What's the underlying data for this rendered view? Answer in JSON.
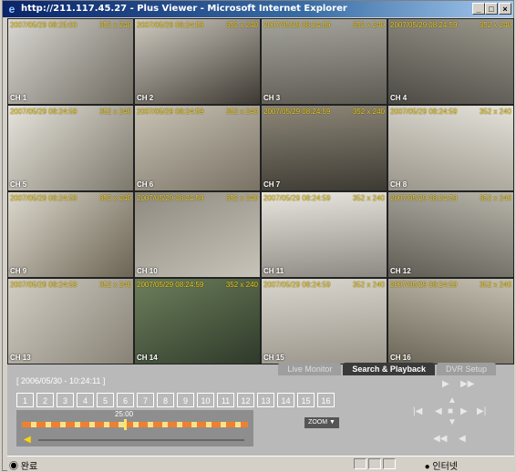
{
  "window": {
    "title": "http://211.117.45.27 - Plus Viewer - Microsoft Internet Explorer",
    "minimize": "_",
    "maximize": "□",
    "close": "×"
  },
  "cameras": [
    {
      "timestamp": "2007/05/29 08:25:00",
      "res": "352 x 240",
      "label": "CH 1",
      "colors": [
        "#d9d7d2",
        "#6e6a60"
      ]
    },
    {
      "timestamp": "2007/05/29 08:24:59",
      "res": "352 x 240",
      "label": "CH 2",
      "colors": [
        "#cfcac0",
        "#3e3a33"
      ]
    },
    {
      "timestamp": "2007/05/29 08:24:59",
      "res": "352 x 240",
      "label": "CH 3",
      "colors": [
        "#a5a49c",
        "#5d5a52"
      ]
    },
    {
      "timestamp": "2007/05/29 08:24:59",
      "res": "352 x 240",
      "label": "CH 4",
      "colors": [
        "#9a978c",
        "#4c4a44"
      ]
    },
    {
      "timestamp": "2007/05/29 08:24:59",
      "res": "352 x 240",
      "label": "CH 5",
      "colors": [
        "#e6e4dc",
        "#7d786c"
      ]
    },
    {
      "timestamp": "2007/05/29 08:24:59",
      "res": "352 x 240",
      "label": "CH 6",
      "colors": [
        "#c8c3b5",
        "#7a7264"
      ]
    },
    {
      "timestamp": "2007/05/29 08:24:59",
      "res": "352 x 240",
      "label": "CH 7",
      "colors": [
        "#8d8778",
        "#3d3a33"
      ]
    },
    {
      "timestamp": "2007/05/29 08:24:59",
      "res": "352 x 240",
      "label": "CH 8",
      "colors": [
        "#e4e2da",
        "#9a958a"
      ]
    },
    {
      "timestamp": "2007/05/29 08:24:59",
      "res": "352 x 240",
      "label": "CH 9",
      "colors": [
        "#dcd8cc",
        "#6c6454"
      ]
    },
    {
      "timestamp": "2007/05/29 08:24:59",
      "res": "352 x 240",
      "label": "CH 10",
      "colors": [
        "#8e8a80",
        "#c7c3b8"
      ]
    },
    {
      "timestamp": "2007/05/29 08:24:59",
      "res": "352 x 240",
      "label": "CH 11",
      "colors": [
        "#e8e6de",
        "#8c8a82"
      ]
    },
    {
      "timestamp": "2007/05/29 08:24:59",
      "res": "352 x 240",
      "label": "CH 12",
      "colors": [
        "#b8b5ab",
        "#5e5b53"
      ]
    },
    {
      "timestamp": "2007/05/29 08:24:59",
      "res": "352 x 240",
      "label": "CH 13",
      "colors": [
        "#d2cec4",
        "#888276"
      ]
    },
    {
      "timestamp": "2007/05/29 08:24:59",
      "res": "352 x 240",
      "label": "CH 14",
      "colors": [
        "#6d7f5c",
        "#2f3a2a"
      ]
    },
    {
      "timestamp": "2007/05/29 08:24:59",
      "res": "352 x 240",
      "label": "CH 15",
      "colors": [
        "#d8d5ce",
        "#9c978c"
      ]
    },
    {
      "timestamp": "2007/05/29 08:24:59",
      "res": "352 x 240",
      "label": "CH 16",
      "colors": [
        "#c5c0b2",
        "#6a6556"
      ]
    }
  ],
  "tabs": [
    "Live Monitor",
    "Search & Playback",
    "DVR Setup"
  ],
  "active_tab": 1,
  "playback": {
    "datetime": "[ 2006/05/30 - 10:24:11 ]",
    "channel_buttons": [
      "1",
      "2",
      "3",
      "4",
      "5",
      "6",
      "7",
      "8",
      "9",
      "10",
      "11",
      "12",
      "13",
      "14",
      "15",
      "16"
    ],
    "timeline_time": "25:00",
    "zoom_label": "ZOOM ▼"
  },
  "status": {
    "left": "완료",
    "zone": "인터넷"
  },
  "colors": {
    "timestamp_text": "#f5d31f",
    "control_bg": "#b9b9b9"
  }
}
